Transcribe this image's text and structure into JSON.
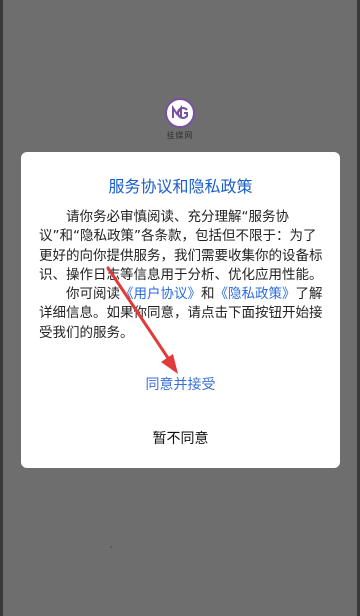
{
  "logo": {
    "text": "挂媒网"
  },
  "dialog": {
    "title": "服务协议和隐私政策",
    "para1": "请你务必审慎阅读、充分理解“服务协议”和“隐私政策”各条款，包括但不限于：为了更好的向你提供服务，我们需要收集你的设备标识、操作日志等信息用于分析、优化应用性能。",
    "para2_prefix": "你可阅读",
    "user_agreement_link": "《用户协议》",
    "para2_and": "和",
    "privacy_policy_link": "《隐私政策》",
    "para2_suffix": "了解详细信息。如果你同意，请点击下面按钮开始接受我们的服务。",
    "agree_label": "同意并接受",
    "disagree_label": "暂不同意"
  },
  "colors": {
    "background": "#6e6e6e",
    "title": "#1a5ec8",
    "link": "#2a6be0",
    "arrow": "#e23a3a"
  }
}
